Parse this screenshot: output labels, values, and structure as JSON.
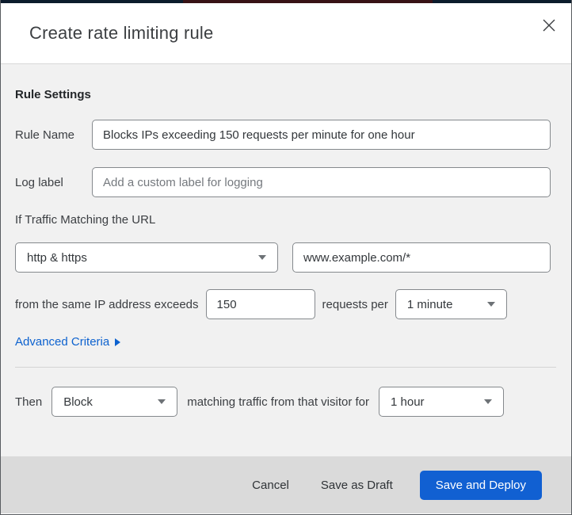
{
  "modal": {
    "title": "Create rate limiting rule"
  },
  "rule_settings": {
    "heading": "Rule Settings",
    "rule_name": {
      "label": "Rule Name",
      "value": "Blocks IPs exceeding 150 requests per minute for one hour"
    },
    "log_label": {
      "label": "Log label",
      "placeholder": "Add a custom label for logging"
    },
    "traffic_heading": "If Traffic Matching the URL",
    "scheme_select": {
      "selected": "http & https"
    },
    "url_pattern": {
      "value": "www.example.com/*"
    },
    "threshold": {
      "prefix_text": "from the same IP address exceeds",
      "count_value": "150",
      "unit_text": "requests per",
      "period_selected": "1 minute"
    },
    "advanced_criteria_label": "Advanced Criteria",
    "then": {
      "label": "Then",
      "action_selected": "Block",
      "middle_text": "matching traffic from that visitor for",
      "duration_selected": "1 hour"
    }
  },
  "footer": {
    "cancel_label": "Cancel",
    "save_draft_label": "Save as Draft",
    "save_deploy_label": "Save and Deploy"
  },
  "colors": {
    "primary_button_bg": "#1160d2",
    "primary_button_text": "#ffffff",
    "link_blue": "#0d62cf",
    "body_bg": "#f1f1f1",
    "footer_bg": "#dadada",
    "input_border": "#85898d",
    "top_strip_navy": "#0c1c2c",
    "top_strip_maroon": "#381216"
  }
}
